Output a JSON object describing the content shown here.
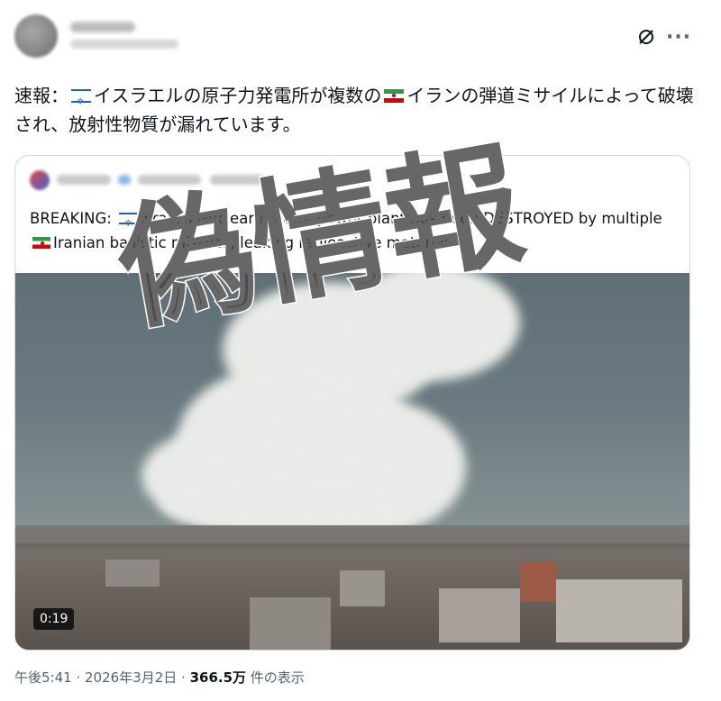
{
  "header": {
    "avatar_icon": "avatar-blurred",
    "grok_icon": "slashed-circle-icon",
    "more_icon": "more-dots-icon",
    "more_label": "···"
  },
  "tweet": {
    "text_part1": "速報：",
    "flag1": "israel-flag-icon",
    "text_part2": "イスラエルの原子力発電所が複数の",
    "flag2": "iran-flag-icon",
    "text_part3": "イランの弾道ミサイルによって破壊され、放射性物質が漏れています。"
  },
  "quote": {
    "text_part1": "BREAKING: ",
    "text_part2": "Israel's Nuclear reactor power plant has been DESTROYED by multiple",
    "text_part3": "Iranian ballistic missiles, leaking radioactive material.",
    "video_duration": "0:19"
  },
  "watermark": {
    "text": "偽情報",
    "color": "#4a4a4a"
  },
  "footer": {
    "time": "午後5:41",
    "sep1": " · ",
    "date": "2026年3月2日",
    "sep2": " · ",
    "views": "366.5万",
    "views_label": " 件の表示"
  }
}
